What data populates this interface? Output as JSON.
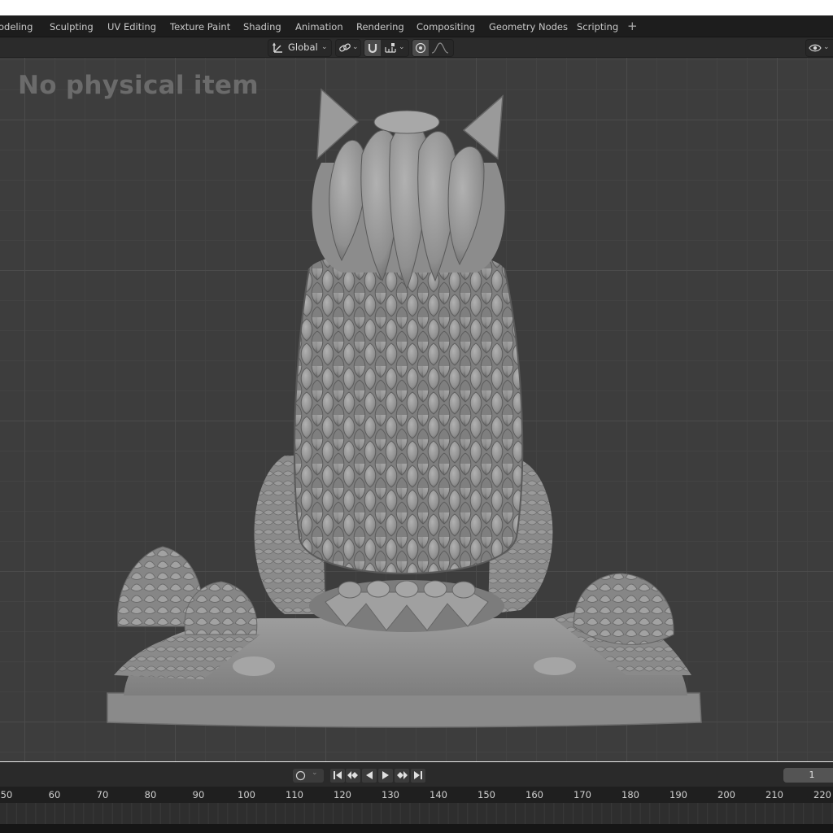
{
  "workspace_tabs": [
    {
      "label": "odeling",
      "active": false
    },
    {
      "label": "Sculpting",
      "active": false
    },
    {
      "label": "UV Editing",
      "active": false
    },
    {
      "label": "Texture Paint",
      "active": false
    },
    {
      "label": "Shading",
      "active": false
    },
    {
      "label": "Animation",
      "active": false
    },
    {
      "label": "Rendering",
      "active": false
    },
    {
      "label": "Compositing",
      "active": false
    },
    {
      "label": "Geometry Nodes",
      "active": false
    },
    {
      "label": "Scripting",
      "active": false
    }
  ],
  "add_workspace": "+",
  "header": {
    "transform_orientation": "Global"
  },
  "viewport": {
    "overlay_text": "No physical item"
  },
  "timeline": {
    "current_frame": "1",
    "ruler_ticks": [
      "50",
      "60",
      "70",
      "80",
      "90",
      "100",
      "110",
      "120",
      "130",
      "140",
      "150",
      "160",
      "170",
      "180",
      "190",
      "200",
      "210",
      "220"
    ]
  },
  "colors": {
    "viewport_bg": "#3d3d3d",
    "model_gray": "#8f8f8f",
    "overlay_text": "#6b6b6b",
    "topbar_bg": "#1d1d1d"
  }
}
